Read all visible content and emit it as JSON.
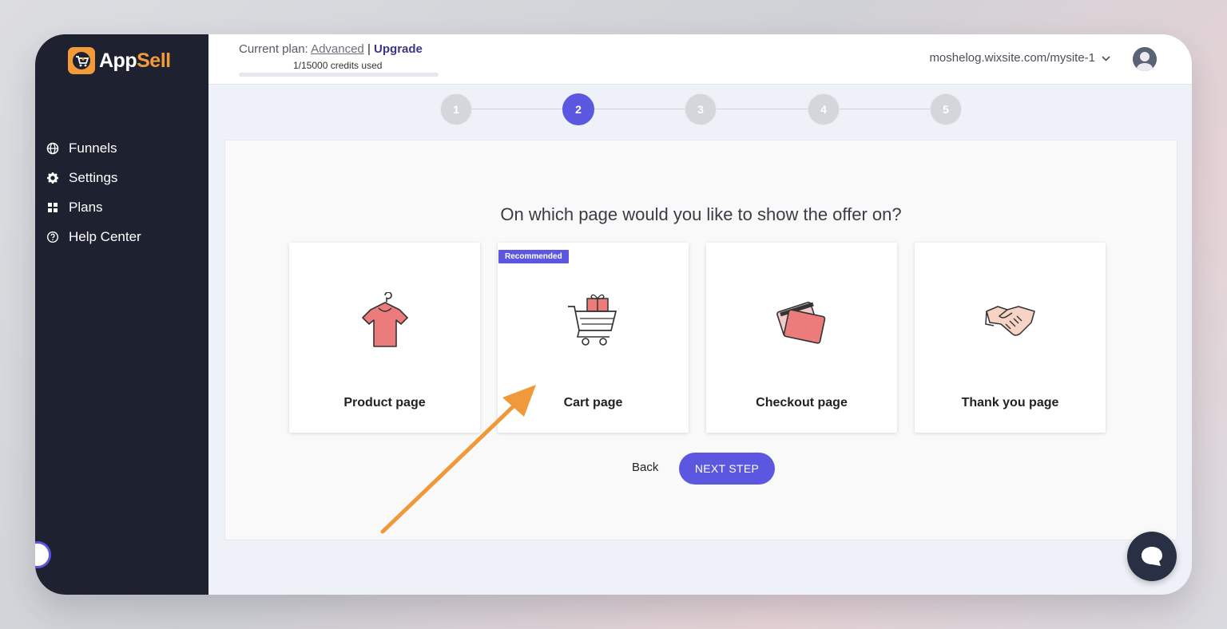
{
  "app": {
    "logo_app": "App",
    "logo_sell": "Sell"
  },
  "sidebar": {
    "items": [
      {
        "label": "Funnels",
        "icon": "globe-icon"
      },
      {
        "label": "Settings",
        "icon": "gear-icon"
      },
      {
        "label": "Plans",
        "icon": "grid-icon"
      },
      {
        "label": "Help Center",
        "icon": "help-circle-icon"
      }
    ]
  },
  "header": {
    "plan_prefix": "Current plan:",
    "plan_name": "Advanced",
    "separator": "|",
    "upgrade": "Upgrade",
    "credits": "1/15000 credits used",
    "credits_used_fraction": 6.67e-05,
    "site": "moshelog.wixsite.com/mysite-1"
  },
  "stepper": {
    "steps": [
      "1",
      "2",
      "3",
      "4",
      "5"
    ],
    "active": 2
  },
  "main": {
    "question": "On which page would you like to show the offer on?",
    "cards": [
      {
        "label": "Product page",
        "icon": "tshirt-icon"
      },
      {
        "label": "Cart page",
        "icon": "cart-gift-icon",
        "badge": "Recommended"
      },
      {
        "label": "Checkout page",
        "icon": "credit-card-icon"
      },
      {
        "label": "Thank you page",
        "icon": "handshake-icon"
      }
    ],
    "back": "Back",
    "next": "NEXT STEP"
  },
  "colors": {
    "accent": "#5b57e0",
    "sidebar": "#1e2130",
    "brand_orange": "#f29b38",
    "annotation_arrow": "#f0993a"
  }
}
